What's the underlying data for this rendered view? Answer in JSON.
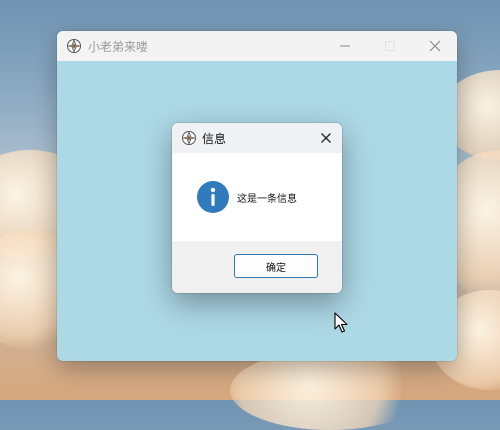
{
  "main_window": {
    "title": "小老弟来喽",
    "icon": "app-flower-icon",
    "controls": [
      "minimize-icon",
      "maximize-icon",
      "close-icon"
    ]
  },
  "dialog": {
    "title": "信息",
    "icon": "app-flower-icon",
    "message": "这是一条信息",
    "message_icon": "info-icon",
    "ok_label": "确定"
  },
  "colors": {
    "window_background": "#add8e6",
    "info_icon": "#2f7bbd",
    "button_border": "#2a7ab8"
  }
}
